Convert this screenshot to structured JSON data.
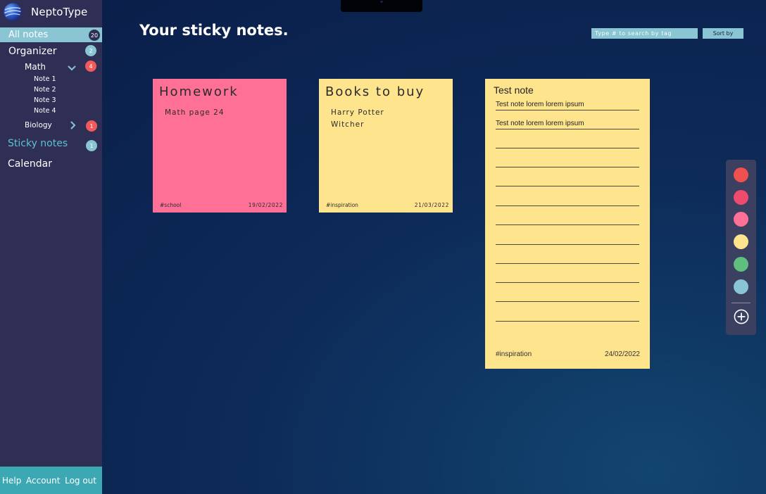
{
  "app": {
    "name": "NeptoType"
  },
  "sidebar": {
    "all_notes": {
      "label": "All notes",
      "count": "20"
    },
    "organizer": {
      "label": "Organizer",
      "count": "2"
    },
    "math": {
      "label": "Math",
      "count": "4",
      "expanded": true
    },
    "math_notes": [
      "Note 1",
      "Note 2",
      "Note 3",
      "Note 4"
    ],
    "biology": {
      "label": "Biology",
      "count": "1"
    },
    "sticky_notes": {
      "label": "Sticky notes",
      "count": "1"
    },
    "calendar": {
      "label": "Calendar"
    },
    "footer": {
      "help": "Help",
      "account": "Account",
      "logout": "Log out"
    }
  },
  "header": {
    "title": "Your sticky notes.",
    "search_placeholder": "Type # to search by tag",
    "sort_label": "Sort by"
  },
  "notes": [
    {
      "title": "Homework",
      "lines": [
        "Math page 24"
      ],
      "tag": "#school",
      "date": "19/02/2022",
      "color": "#ff7097"
    },
    {
      "title": "Books to buy",
      "lines": [
        "Harry Potter",
        "Witcher"
      ],
      "tag": "#inspiration",
      "date": "21/03/2022",
      "color": "#ffe48e"
    },
    {
      "title": "Test note",
      "lines": [
        "Test note lorem lorem ipsum",
        "Test note lorem lorem ipsum"
      ],
      "tag": "#inspiration",
      "date": "24/02/2022",
      "color": "#ffe48e"
    }
  ],
  "palette": {
    "colors": [
      "#f05050",
      "#f04a6e",
      "#ff7097",
      "#ffe48e",
      "#5fbf7f",
      "#89c5d3"
    ],
    "add_icon": "plus-circle-icon"
  },
  "colors": {
    "sidebar": "#2f2e55",
    "accent": "#89c5d3",
    "footer": "#3ba8b4",
    "active_link": "#5fc0d3"
  }
}
